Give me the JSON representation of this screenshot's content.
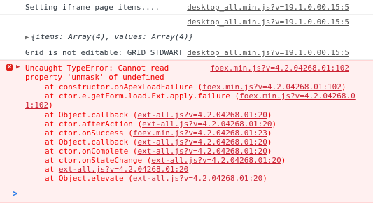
{
  "logs": [
    {
      "message": "Setting iframe page items....",
      "source": "desktop_all.min.js?v=19.1.0.00.15:5"
    },
    {
      "message": "",
      "source": "desktop_all.min.js?v=19.1.0.00.15:5"
    },
    {
      "message": "{items: Array(4), values: Array(4)}",
      "source": ""
    },
    {
      "message": "Grid is not editable: GRID_STDWART",
      "source": "desktop_all.min.js?v=19.1.0.00.15:5"
    }
  ],
  "error": {
    "line1": "Uncaught TypeError: Cannot read",
    "line2": "property 'unmask' of undefined",
    "source": "foex.min.js?v=4.2.04268.01:102",
    "frames": [
      {
        "prefix": "at constructor.onApexLoadFailure (",
        "link": "foex.min.js?v=4.2.04268.01:102",
        "suffix": ")"
      },
      {
        "prefix": "at ctor.e.getForm.load.Ext.apply.failure (",
        "link": "foex.min.js?v=4.2.04268.0",
        "suffix": ""
      },
      {
        "prefix": "",
        "link": "1:102",
        "suffix": ")"
      },
      {
        "prefix": "at Object.callback (",
        "link": "ext-all.js?v=4.2.04268.01:20",
        "suffix": ")"
      },
      {
        "prefix": "at ctor.afterAction (",
        "link": "ext-all.js?v=4.2.04268.01:20",
        "suffix": ")"
      },
      {
        "prefix": "at ctor.onSuccess (",
        "link": "foex.min.js?v=4.2.04268.01:23",
        "suffix": ")"
      },
      {
        "prefix": "at Object.callback (",
        "link": "ext-all.js?v=4.2.04268.01:20",
        "suffix": ")"
      },
      {
        "prefix": "at ctor.onComplete (",
        "link": "ext-all.js?v=4.2.04268.01:20",
        "suffix": ")"
      },
      {
        "prefix": "at ctor.onStateChange (",
        "link": "ext-all.js?v=4.2.04268.01:20",
        "suffix": ")"
      },
      {
        "prefix": "at ",
        "link": "ext-all.js?v=4.2.04268.01:20",
        "suffix": ""
      },
      {
        "prefix": "at Object.elevate (",
        "link": "ext-all.js?v=4.2.04268.01:20",
        "suffix": ")"
      }
    ]
  },
  "prompt": {
    "symbol": ">"
  },
  "colors": {
    "error_text": "#f00000",
    "error_bg": "#fff0f0",
    "link_error": "#cc2233",
    "prompt": "#1a73e8"
  }
}
